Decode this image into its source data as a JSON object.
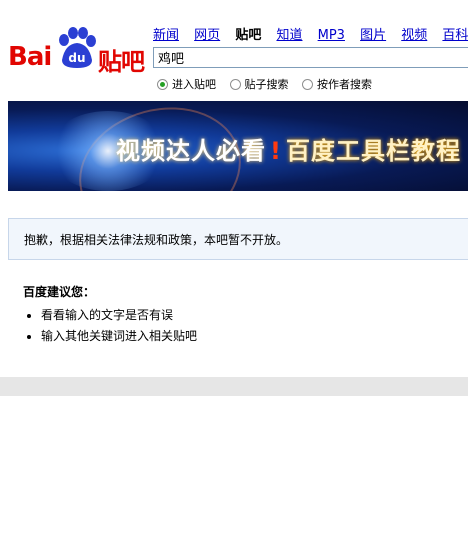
{
  "logo": {
    "brand_text": "Bai",
    "paw_text": "du",
    "tieba_text": "贴吧"
  },
  "nav": {
    "items": [
      {
        "label": "新闻",
        "active": false
      },
      {
        "label": "网页",
        "active": false
      },
      {
        "label": "贴吧",
        "active": true
      },
      {
        "label": "知道",
        "active": false
      },
      {
        "label": "MP3",
        "active": false
      },
      {
        "label": "图片",
        "active": false
      },
      {
        "label": "视频",
        "active": false
      },
      {
        "label": "百科",
        "active": false
      }
    ]
  },
  "search": {
    "value": "鸡吧"
  },
  "radios": [
    {
      "label": "进入贴吧",
      "checked": true
    },
    {
      "label": "贴子搜索",
      "checked": false
    },
    {
      "label": "按作者搜索",
      "checked": false
    }
  ],
  "banner": {
    "text_main": "视频达人必看",
    "text_bang": "!",
    "text_sub": "百度工具栏教程"
  },
  "notice": {
    "text": "抱歉，根据相关法律法规和政策，本吧暂不开放。"
  },
  "tips": {
    "title": "百度建议您：",
    "items": [
      "看看输入的文字是否有误",
      "输入其他关键词进入相关贴吧"
    ]
  },
  "colors": {
    "brand_red": "#e10602",
    "paw_blue": "#2b3fd3",
    "link_blue": "#0000cc"
  }
}
